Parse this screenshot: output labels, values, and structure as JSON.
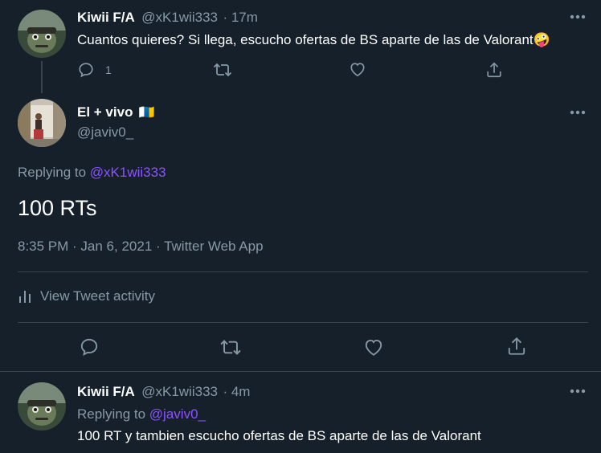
{
  "tweet1": {
    "name": "Kiwii F/A",
    "handle": "@xK1wii333",
    "time": "· 17m",
    "text": "Cuantos quieres? Si llega, escucho ofertas de BS aparte de las de Valorant",
    "emoji": "🤪",
    "reply_count": "1",
    "icons": [
      "reply-icon",
      "retweet-icon",
      "like-icon",
      "share-icon",
      "more-icon"
    ]
  },
  "main_tweet": {
    "name": "El + vivo",
    "flag": "🇮🇨",
    "handle": "@javiv0_",
    "replying_prefix": "Replying to",
    "replying_to": "@xK1wii333",
    "text": "100 RTs",
    "timestamp": "8:35 PM · Jan 6, 2021 · Twitter Web App",
    "activity_label": "View Tweet activity",
    "icons": [
      "reply-icon",
      "retweet-icon",
      "like-icon",
      "share-icon",
      "more-icon",
      "activity-icon"
    ]
  },
  "tweet3": {
    "name": "Kiwii F/A",
    "handle": "@xK1wii333",
    "time": "· 4m",
    "replying_prefix": "Replying to",
    "replying_to": "@javiv0_",
    "text": "100 RT y tambien escucho ofertas de BS aparte de las de Valorant"
  },
  "colors": {
    "background": "#15202b",
    "text": "#ffffff",
    "muted": "#8899a6",
    "link": "#8c52ff",
    "divider": "#38444d"
  }
}
